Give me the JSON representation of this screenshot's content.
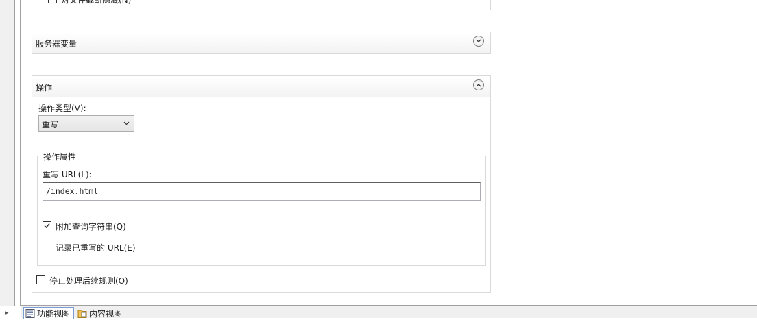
{
  "server_vars_panel": {
    "title": "服务器变量",
    "state": "collapsed"
  },
  "top_panel": {
    "partial_checkbox_label": "对文件截断隐藏(N)"
  },
  "action_panel": {
    "title": "操作",
    "state": "expanded",
    "action_type_label": "操作类型(V):",
    "action_type_value": "重写",
    "properties_legend": "操作属性",
    "rewrite_url_label": "重写 URL(L):",
    "rewrite_url_value": "/index.html",
    "append_query_label": "附加查询字符串(Q)",
    "append_query_checked": true,
    "log_rewritten_label": "记录已重写的 URL(E)",
    "log_rewritten_checked": false,
    "stop_processing_label": "停止处理后续规则(O)",
    "stop_processing_checked": false
  },
  "bottom_tabs": [
    {
      "label": "功能视图",
      "icon": "features-view-icon",
      "active": true
    },
    {
      "label": "内容视图",
      "icon": "content-view-icon",
      "active": false
    }
  ]
}
